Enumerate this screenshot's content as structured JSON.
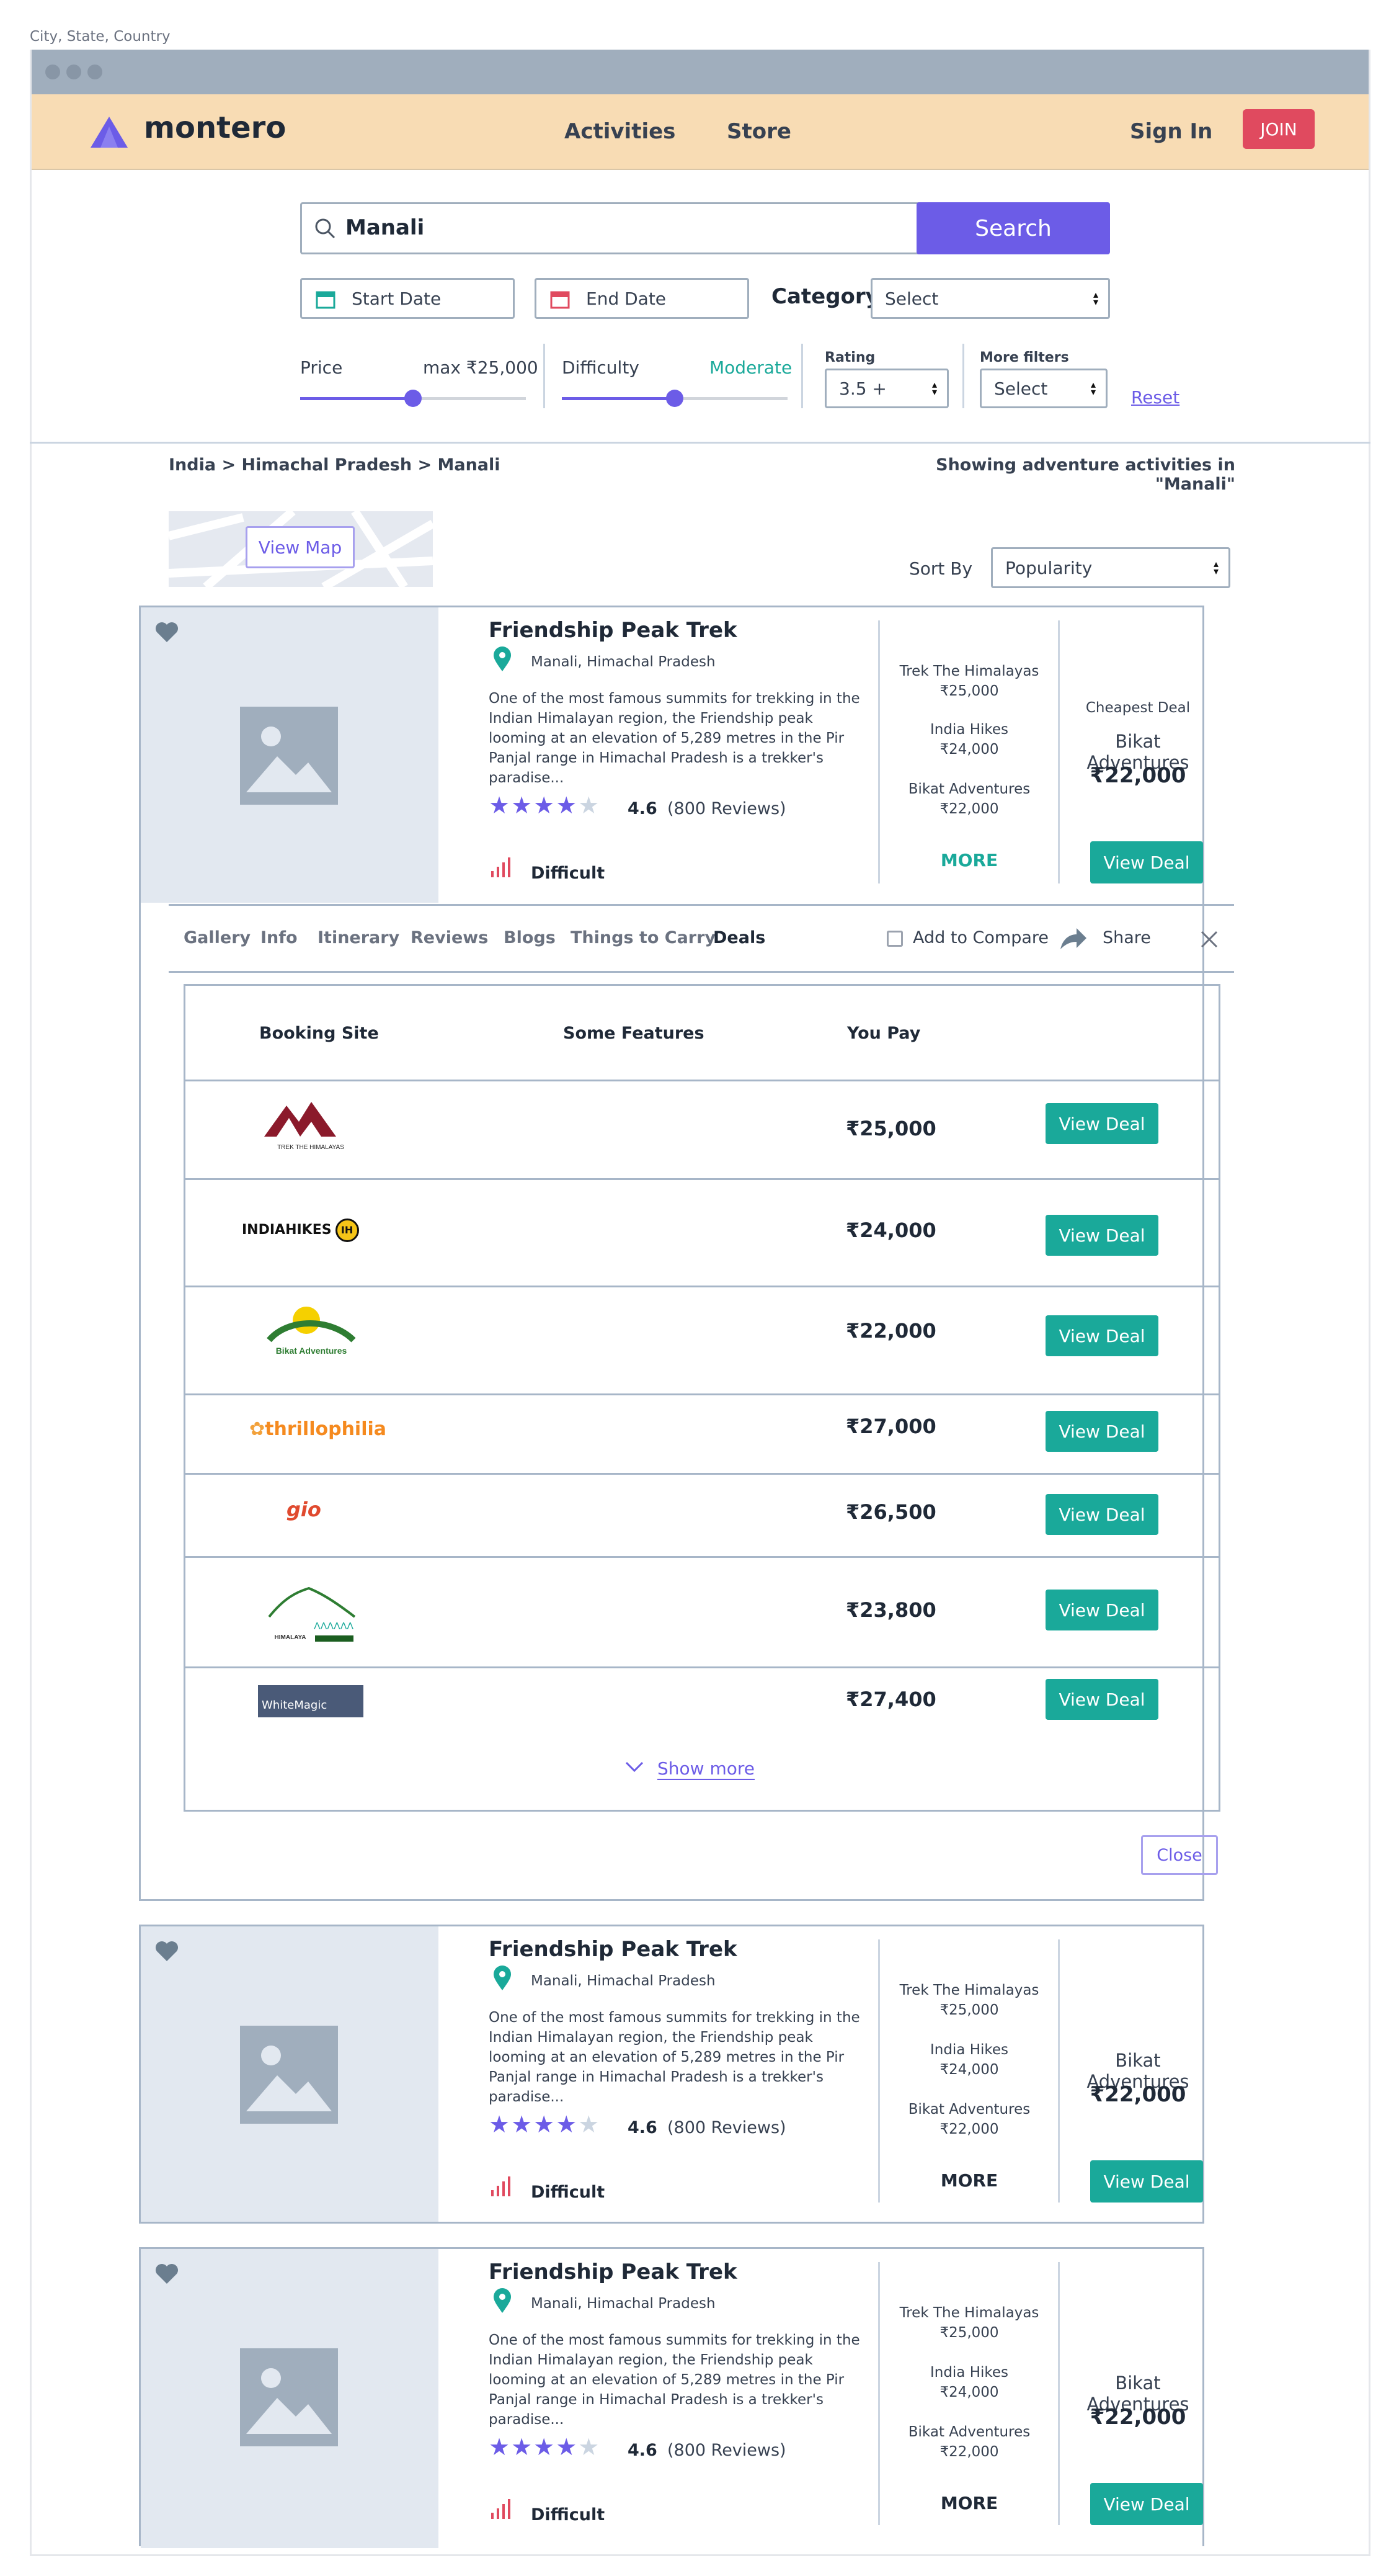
{
  "location_label": "City, State, Country",
  "brand": {
    "name": "montero"
  },
  "nav": {
    "activities": "Activities",
    "store": "Store",
    "sign_in": "Sign In",
    "join": "JOIN"
  },
  "search": {
    "value": "Manali",
    "button": "Search",
    "start_date": "Start Date",
    "end_date": "End Date",
    "category_label": "Category",
    "category_value": "Select"
  },
  "filters": {
    "price_label": "Price",
    "price_max": "max ₹25,000",
    "difficulty_label": "Difficulty",
    "difficulty_value": "Moderate",
    "rating_label": "Rating",
    "rating_value": "3.5 +",
    "more_label": "More filters",
    "more_value": "Select",
    "reset": "Reset",
    "price_level": 0.5,
    "difficulty_level": 0.5
  },
  "breadcrumb": "India > Himachal Pradesh > Manali",
  "showing": "Showing adventure activities in \"Manali\"",
  "view_map": "View Map",
  "sort": {
    "label": "Sort By",
    "value": "Popularity"
  },
  "cards": [
    {
      "title": "Friendship Peak Trek",
      "location": "Manali, Himachal Pradesh",
      "description": "One of the most famous summits for trekking in the Indian Himalayan region, the Friendship peak looming at an elevation of 5,289 metres in the Pir Panjal range in Himachal Pradesh is a trekker's paradise...",
      "rating": "4.6",
      "reviews": "(800 Reviews)",
      "stars": 4,
      "difficulty": "Difficult",
      "offers": [
        {
          "site": "Trek The Himalayas",
          "price": "₹25,000"
        },
        {
          "site": "India Hikes",
          "price": "₹24,000"
        },
        {
          "site": "Bikat Adventures",
          "price": "₹22,000"
        }
      ],
      "more": "MORE",
      "cheapest_label": "Cheapest Deal",
      "cheapest_site": "Bikat Adventures",
      "cheapest_price": "₹22,000",
      "view_deal": "View Deal"
    },
    {
      "title": "Friendship Peak Trek",
      "location": "Manali, Himachal Pradesh",
      "description": "One of the most famous summits for trekking in the Indian Himalayan region, the Friendship peak looming at an elevation of 5,289 metres in the Pir Panjal range in Himachal Pradesh is a trekker's paradise...",
      "rating": "4.6",
      "reviews": "(800 Reviews)",
      "stars": 4,
      "difficulty": "Difficult",
      "offers": [
        {
          "site": "Trek The Himalayas",
          "price": "₹25,000"
        },
        {
          "site": "India Hikes",
          "price": "₹24,000"
        },
        {
          "site": "Bikat Adventures",
          "price": "₹22,000"
        }
      ],
      "more": "MORE",
      "cheapest_site": "Bikat Adventures",
      "cheapest_price": "₹22,000",
      "view_deal": "View Deal"
    },
    {
      "title": "Friendship Peak Trek",
      "location": "Manali, Himachal Pradesh",
      "description": "One of the most famous summits for trekking in the Indian Himalayan region, the Friendship peak looming at an elevation of 5,289 metres in the Pir Panjal range in Himachal Pradesh is a trekker's paradise...",
      "rating": "4.6",
      "reviews": "(800 Reviews)",
      "stars": 4,
      "difficulty": "Difficult",
      "offers": [
        {
          "site": "Trek The Himalayas",
          "price": "₹25,000"
        },
        {
          "site": "India Hikes",
          "price": "₹24,000"
        },
        {
          "site": "Bikat Adventures",
          "price": "₹22,000"
        }
      ],
      "more": "MORE",
      "cheapest_site": "Bikat Adventures",
      "cheapest_price": "₹22,000",
      "view_deal": "View Deal"
    }
  ],
  "tabs": [
    "Gallery",
    "Info",
    "Itinerary",
    "Reviews",
    "Blogs",
    "Things to Carry",
    "Deals"
  ],
  "active_tab": "Deals",
  "compare": "Add to Compare",
  "share": "Share",
  "deals_table": {
    "headers": [
      "Booking Site",
      "Some Features",
      "You Pay"
    ],
    "rows": [
      {
        "logo": "TREK THE HIMALAYAS",
        "price": "₹25,000",
        "action": "View Deal"
      },
      {
        "logo": "INDIAHIKES",
        "price": "₹24,000",
        "action": "View Deal"
      },
      {
        "logo": "Bikat Adventures",
        "price": "₹22,000",
        "action": "View Deal"
      },
      {
        "logo": "thrillophilia",
        "price": "₹27,000",
        "action": "View Deal"
      },
      {
        "logo": "gio",
        "price": "₹26,500",
        "action": "View Deal"
      },
      {
        "logo": "HIMALAYA",
        "price": "₹23,800",
        "action": "View Deal"
      },
      {
        "logo": "WhiteMagic",
        "price": "₹27,400",
        "action": "View Deal"
      }
    ],
    "show_more": "Show more",
    "close": "Close"
  },
  "colors": {
    "accent": "#6c5ce7",
    "teal": "#1aa99a",
    "nav_bg": "#f8dcb4",
    "join": "#e04a5f"
  }
}
